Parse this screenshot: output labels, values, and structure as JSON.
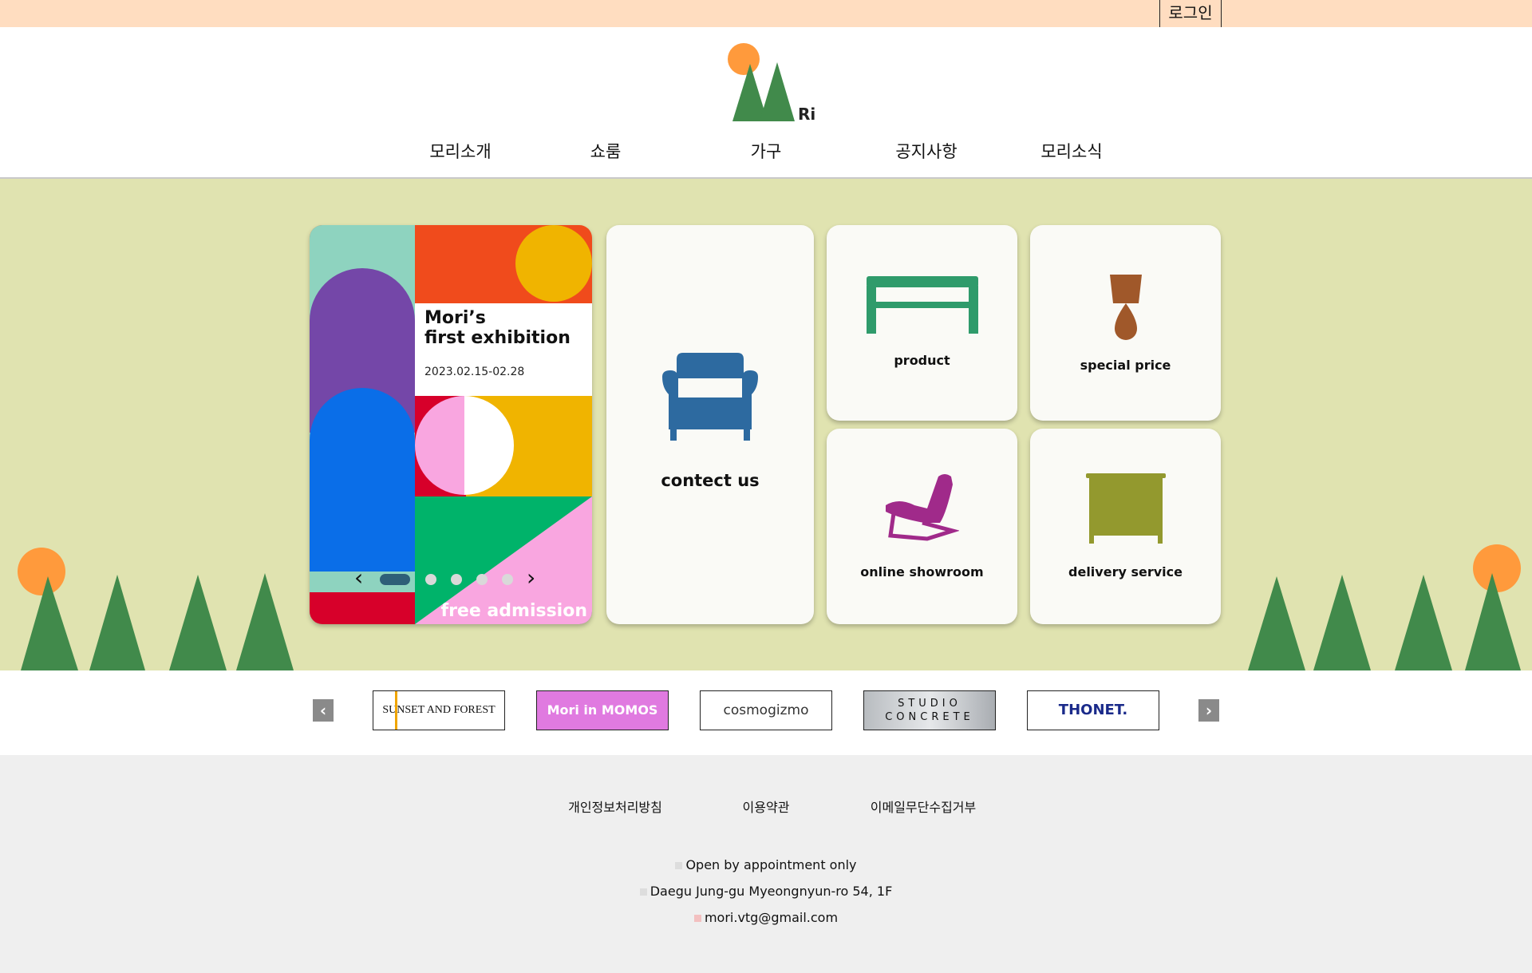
{
  "topbar": {
    "login_label": "로그인"
  },
  "header": {
    "logo_text": "Ri",
    "nav": [
      {
        "label": "모리소개"
      },
      {
        "label": "쇼룸"
      },
      {
        "label": "가구"
      },
      {
        "label": "공지사항"
      },
      {
        "label": "모리소식"
      }
    ]
  },
  "banner": {
    "title": "Mori’s\nfirst exhibition",
    "date": "2023.02.15-02.28",
    "free_label": "free admission",
    "prev_icon": "chevron-left-icon",
    "next_icon": "chevron-right-icon",
    "slide_count": 5,
    "active_slide": 1
  },
  "cards": {
    "contact": {
      "label": "contect us",
      "icon": "armchair-icon",
      "color": "#2d6aa0"
    },
    "product": {
      "label": "product",
      "icon": "table-icon",
      "color": "#2f9b6b"
    },
    "special": {
      "label": "special price",
      "icon": "lamp-icon",
      "color": "#a0582a"
    },
    "showroom": {
      "label": "online showroom",
      "icon": "lounge-chair-icon",
      "color": "#a02a8a"
    },
    "delivery": {
      "label": "delivery service",
      "icon": "cabinet-icon",
      "color": "#93992e"
    }
  },
  "partners": [
    {
      "label": "SUNSET AND FOREST"
    },
    {
      "label": "Mori in MOMOS"
    },
    {
      "label": "cosmogizmo"
    },
    {
      "label": "STUDIO\nCONCRETE"
    },
    {
      "label": "THONET."
    }
  ],
  "footer": {
    "links": [
      {
        "label": "개인정보처리방침"
      },
      {
        "label": "이용약관"
      },
      {
        "label": "이메일무단수집거부"
      }
    ],
    "hours": "Open by appointment only",
    "address": "Daegu Jung-gu Myeongnyun-ro 54, 1F",
    "email": "mori.vtg@gmail.com"
  },
  "colors": {
    "topbar": "#ffddc0",
    "hero": "#e0e3b0",
    "tree": "#418a4b",
    "sun": "#ff9a3c"
  }
}
